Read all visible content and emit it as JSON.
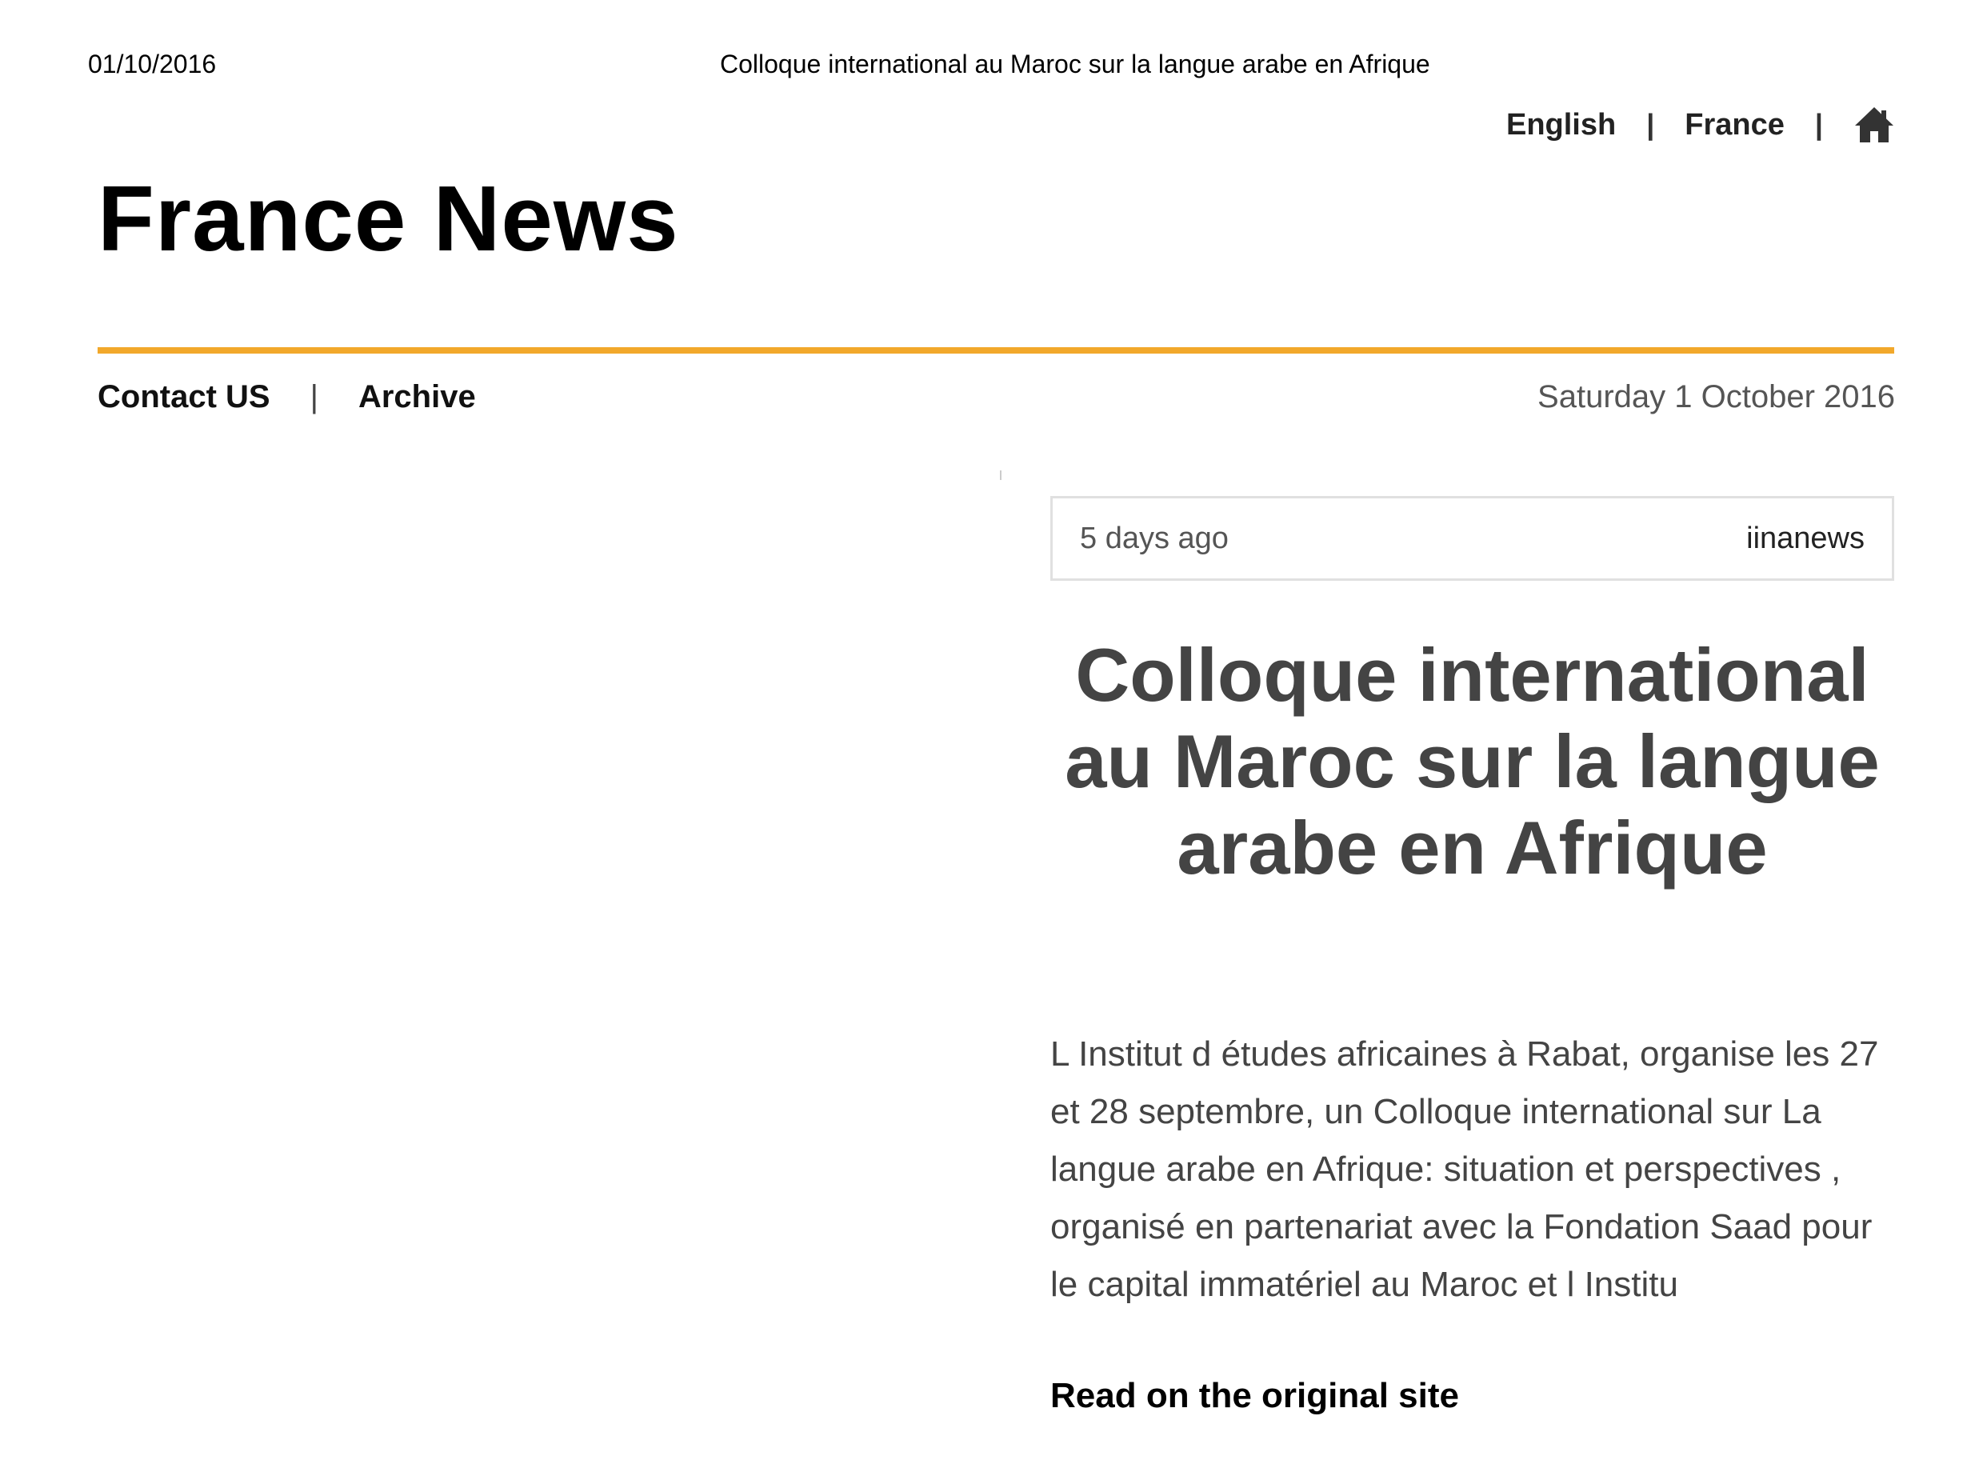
{
  "print_header": {
    "date": "01/10/2016",
    "title": "Colloque international au Maroc sur la langue arabe en Afrique"
  },
  "top_nav": {
    "english": "English",
    "france": "France",
    "separator": "|",
    "home_icon": "home-icon"
  },
  "site": {
    "title": "France News"
  },
  "colors": {
    "accent": "#f2a82b",
    "title_text": "#444444",
    "box_border": "#e0e0e0"
  },
  "sub_nav": {
    "contact": "Contact US",
    "separator": "|",
    "archive": "Archive"
  },
  "page_date": "Saturday 1 October 2016",
  "article": {
    "time_ago": "5 days ago",
    "source": "iinanews",
    "title": "Colloque international au Maroc sur la langue arabe en Afrique",
    "body": "  L Institut d études africaines à Rabat, organise les 27 et 28 septembre, un Colloque international sur La langue arabe en Afrique: situation et perspectives , organisé en partenariat avec la Fondation Saad pour le capital immatériel au Maroc et l Institu",
    "read_more": "Read on the original site"
  }
}
